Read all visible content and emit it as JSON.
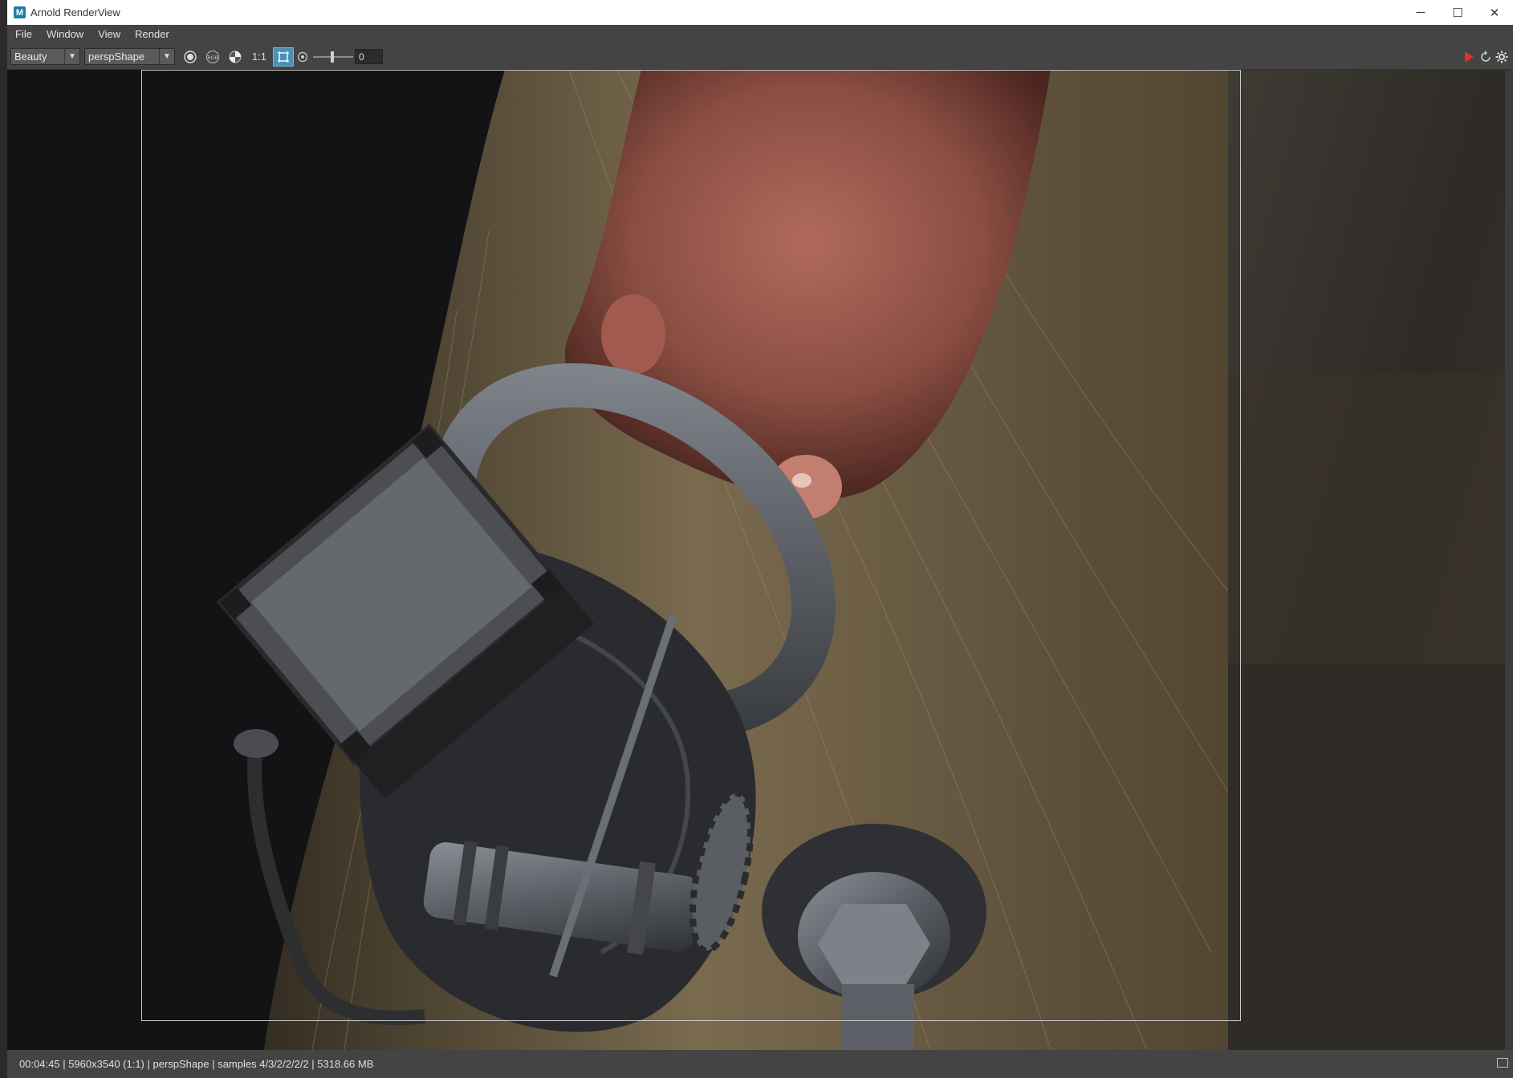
{
  "window": {
    "title": "Arnold RenderView",
    "app_icon_letter": "M"
  },
  "menu": {
    "items": [
      "File",
      "Window",
      "View",
      "Render"
    ]
  },
  "toolbar": {
    "aov": "Beauty",
    "camera": "perspShape",
    "ratio_label": "1:1",
    "exposure_value": "0"
  },
  "statusbar": {
    "text": "00:04:45 | 5960x3540 (1:1) | perspShape  | samples 4/3/2/2/2/2 | 5318.66 MB"
  },
  "colors": {
    "accent": "#4a90b8",
    "render_button": "#e03030",
    "hair": "#8c7a58",
    "skin": "#8a4d42",
    "metal": "#6b7078"
  }
}
